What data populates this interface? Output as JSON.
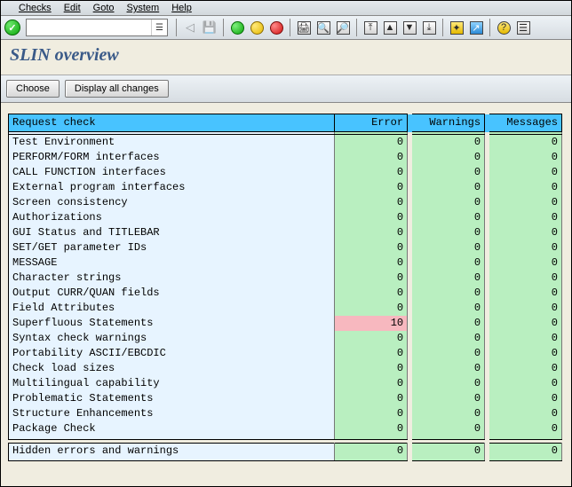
{
  "menubar": {
    "items": [
      "Checks",
      "Edit",
      "Goto",
      "System",
      "Help"
    ]
  },
  "title": "SLIN overview",
  "buttons": {
    "choose": "Choose",
    "display_all": "Display all changes"
  },
  "headers": {
    "label": "Request check",
    "error": "Error",
    "warn": "Warnings",
    "msg": "Messages"
  },
  "rows": [
    {
      "label": "Test Environment",
      "error": 0,
      "warn": 0,
      "msg": 0,
      "err_status": "ok"
    },
    {
      "label": "PERFORM/FORM interfaces",
      "error": 0,
      "warn": 0,
      "msg": 0,
      "err_status": "ok"
    },
    {
      "label": "CALL FUNCTION interfaces",
      "error": 0,
      "warn": 0,
      "msg": 0,
      "err_status": "ok"
    },
    {
      "label": "External program interfaces",
      "error": 0,
      "warn": 0,
      "msg": 0,
      "err_status": "ok"
    },
    {
      "label": "Screen consistency",
      "error": 0,
      "warn": 0,
      "msg": 0,
      "err_status": "ok"
    },
    {
      "label": "Authorizations",
      "error": 0,
      "warn": 0,
      "msg": 0,
      "err_status": "ok"
    },
    {
      "label": "GUI Status and TITLEBAR",
      "error": 0,
      "warn": 0,
      "msg": 0,
      "err_status": "ok"
    },
    {
      "label": "SET/GET parameter IDs",
      "error": 0,
      "warn": 0,
      "msg": 0,
      "err_status": "ok"
    },
    {
      "label": "MESSAGE",
      "error": 0,
      "warn": 0,
      "msg": 0,
      "err_status": "ok"
    },
    {
      "label": "Character strings",
      "error": 0,
      "warn": 0,
      "msg": 0,
      "err_status": "ok"
    },
    {
      "label": "Output CURR/QUAN fields",
      "error": 0,
      "warn": 0,
      "msg": 0,
      "err_status": "ok"
    },
    {
      "label": "Field Attributes",
      "error": 0,
      "warn": 0,
      "msg": 0,
      "err_status": "ok"
    },
    {
      "label": "Superfluous Statements",
      "error": 10,
      "warn": 0,
      "msg": 0,
      "err_status": "err"
    },
    {
      "label": "Syntax check warnings",
      "error": 0,
      "warn": 0,
      "msg": 0,
      "err_status": "ok"
    },
    {
      "label": "Portability ASCII/EBCDIC",
      "error": 0,
      "warn": 0,
      "msg": 0,
      "err_status": "ok"
    },
    {
      "label": "Check load sizes",
      "error": 0,
      "warn": 0,
      "msg": 0,
      "err_status": "ok"
    },
    {
      "label": "Multilingual capability",
      "error": 0,
      "warn": 0,
      "msg": 0,
      "err_status": "ok"
    },
    {
      "label": "Problematic Statements",
      "error": 0,
      "warn": 0,
      "msg": 0,
      "err_status": "ok"
    },
    {
      "label": "Structure Enhancements",
      "error": 0,
      "warn": 0,
      "msg": 0,
      "err_status": "ok"
    },
    {
      "label": "Package Check",
      "error": 0,
      "warn": 0,
      "msg": 0,
      "err_status": "ok"
    }
  ],
  "summary_row": {
    "label": "Hidden errors and warnings",
    "error": 0,
    "warn": 0,
    "msg": 0,
    "err_status": "ok"
  }
}
